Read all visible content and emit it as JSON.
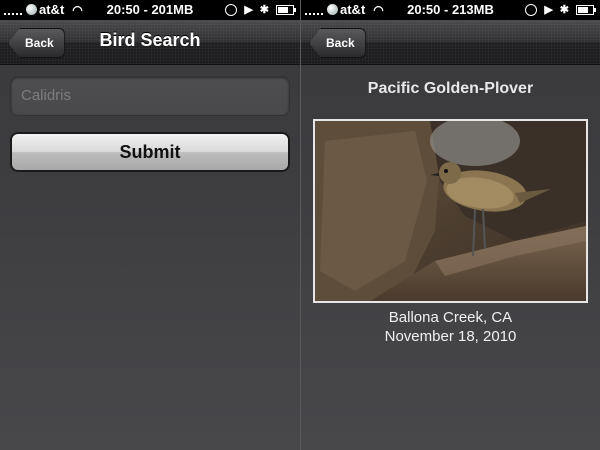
{
  "left": {
    "status": {
      "carrier": "at&t",
      "time": "20:50",
      "memory": "201MB"
    },
    "nav": {
      "back_label": "Back",
      "title": "Bird Search"
    },
    "search": {
      "value": "Calidris"
    },
    "submit_label": "Submit"
  },
  "right": {
    "status": {
      "carrier": "at&t",
      "time": "20:50",
      "memory": "213MB"
    },
    "nav": {
      "back_label": "Back",
      "title": ""
    },
    "bird_name": "Pacific Golden-Plover",
    "photo": {
      "subject": "Pacific Golden-Plover standing on rocks"
    },
    "location": "Ballona Creek, CA",
    "date": "November 18, 2010"
  },
  "icons": {
    "status": [
      "signal-icon",
      "att-globe-icon",
      "wifi-icon",
      "orientation-lock-icon",
      "play-icon",
      "bluetooth-icon",
      "battery-icon"
    ],
    "nav": [
      "back-chevron-icon"
    ]
  },
  "colors": {
    "background": "#3e3e41",
    "statusbar": "#000000",
    "text_light": "#ffffff"
  }
}
